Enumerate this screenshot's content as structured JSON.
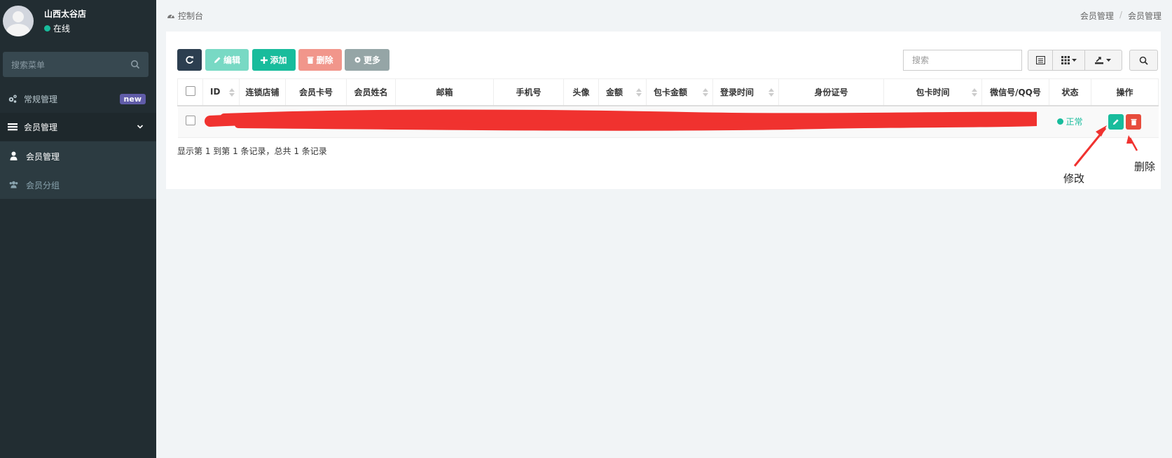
{
  "sidebar": {
    "store_name": "山西太谷店",
    "status": "在线",
    "search_placeholder": "搜索菜单",
    "general_label": "常规管理",
    "general_badge": "new",
    "member_label": "会员管理",
    "sub_member_label": "会员管理",
    "sub_group_label": "会员分组"
  },
  "topbar": {
    "dashboard_label": "控制台",
    "breadcrumb": [
      "会员管理",
      "/",
      "会员管理"
    ]
  },
  "toolbar": {
    "edit_label": "编辑",
    "add_label": "添加",
    "delete_label": "删除",
    "more_label": "更多",
    "search_placeholder": "搜索"
  },
  "table": {
    "columns": [
      "ID",
      "连锁店铺",
      "会员卡号",
      "会员姓名",
      "邮箱",
      "手机号",
      "头像",
      "金额",
      "包卡金额",
      "登录时间",
      "身份证号",
      "包卡时间",
      "微信号/QQ号",
      "状态",
      "操作"
    ],
    "rows": [
      {
        "status": "正常"
      }
    ]
  },
  "pagination": {
    "summary": "显示第 1 到第 1 条记录，总共 1 条记录"
  },
  "annotations": {
    "edit_label": "修改",
    "delete_label": "删除"
  },
  "colors": {
    "sidebar_bg": "#222d32",
    "accent_green": "#18bc9c",
    "danger_red": "#e74c3c",
    "badge_purple": "#605ca8"
  }
}
